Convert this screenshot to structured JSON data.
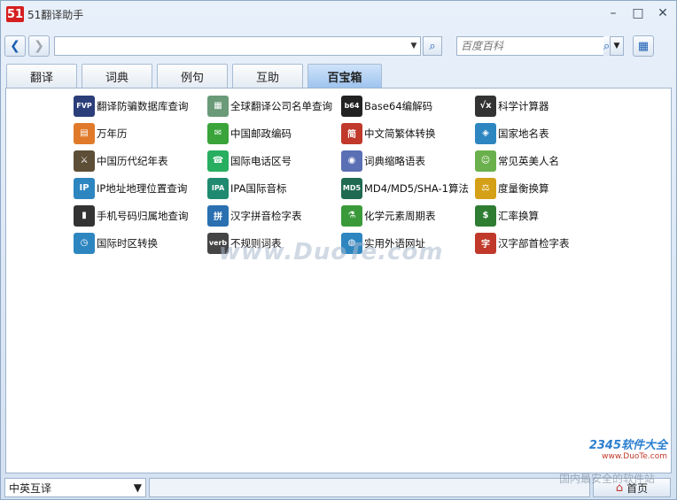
{
  "app": {
    "logo_text": "51",
    "title": "51翻译助手"
  },
  "window_controls": {
    "minimize": "–",
    "maximize": "□",
    "close": "✕"
  },
  "toolbar": {
    "back": "❮",
    "forward": "❯",
    "url_value": "",
    "search_placeholder": "百度百科",
    "dropdown": "▼",
    "search_icon": "⌕",
    "calc_icon": "▦"
  },
  "tabs": [
    {
      "label": "翻译",
      "active": false
    },
    {
      "label": "词典",
      "active": false
    },
    {
      "label": "例句",
      "active": false
    },
    {
      "label": "互助",
      "active": false
    },
    {
      "label": "百宝箱",
      "active": true
    }
  ],
  "tools": [
    {
      "label": "翻译防骗数据库查询",
      "icon": "FVP",
      "color": "#2b3e7a",
      "icon_name": "fraud-database-icon"
    },
    {
      "label": "全球翻译公司名单查询",
      "icon": "▦",
      "color": "#6a9a78",
      "icon_name": "company-list-icon"
    },
    {
      "label": "Base64编解码",
      "icon": "b64",
      "color": "#222222",
      "icon_name": "base64-icon"
    },
    {
      "label": "科学计算器",
      "icon": "√x",
      "color": "#333333",
      "icon_name": "calculator-icon"
    },
    {
      "label": "万年历",
      "icon": "▤",
      "color": "#e07a2a",
      "icon_name": "calendar-icon"
    },
    {
      "label": "中国邮政编码",
      "icon": "✉",
      "color": "#3aa33a",
      "icon_name": "postcode-icon"
    },
    {
      "label": "中文简繁体转换",
      "icon": "简",
      "color": "#c0392b",
      "icon_name": "chinese-convert-icon"
    },
    {
      "label": "国家地名表",
      "icon": "◈",
      "color": "#2e86c1",
      "icon_name": "country-names-icon"
    },
    {
      "label": "中国历代纪年表",
      "icon": "⚔",
      "color": "#5d4e37",
      "icon_name": "chronology-icon"
    },
    {
      "label": "国际电话区号",
      "icon": "☎",
      "color": "#27ae60",
      "icon_name": "phone-code-icon"
    },
    {
      "label": "词典缩略语表",
      "icon": "◉",
      "color": "#5b6fb5",
      "icon_name": "abbreviation-icon"
    },
    {
      "label": "常见英美人名",
      "icon": "☺",
      "color": "#6ab04c",
      "icon_name": "english-names-icon"
    },
    {
      "label": "IP地址地理位置查询",
      "icon": "IP",
      "color": "#2e86c1",
      "icon_name": "ip-lookup-icon"
    },
    {
      "label": "IPA国际音标",
      "icon": "IPA",
      "color": "#1f8a70",
      "icon_name": "ipa-icon"
    },
    {
      "label": "MD4/MD5/SHA-1算法",
      "icon": "MD5",
      "color": "#1f6a50",
      "icon_name": "hash-icon"
    },
    {
      "label": "度量衡换算",
      "icon": "⚖",
      "color": "#d4a017",
      "icon_name": "unit-convert-icon"
    },
    {
      "label": "手机号码归属地查询",
      "icon": "▮",
      "color": "#333333",
      "icon_name": "mobile-lookup-icon"
    },
    {
      "label": "汉字拼音检字表",
      "icon": "拼",
      "color": "#2a6fb0",
      "icon_name": "pinyin-icon"
    },
    {
      "label": "化学元素周期表",
      "icon": "⚗",
      "color": "#3a9a3a",
      "icon_name": "periodic-table-icon"
    },
    {
      "label": "汇率换算",
      "icon": "$",
      "color": "#2e7d32",
      "icon_name": "exchange-rate-icon"
    },
    {
      "label": "国际时区转换",
      "icon": "◷",
      "color": "#2e86c1",
      "icon_name": "timezone-icon"
    },
    {
      "label": "不规则词表",
      "icon": "verb",
      "color": "#444444",
      "icon_name": "irregular-verbs-icon"
    },
    {
      "label": "实用外语网址",
      "icon": "◍",
      "color": "#2e86c1",
      "icon_name": "web-links-icon"
    },
    {
      "label": "汉字部首检字表",
      "icon": "字",
      "color": "#c0392b",
      "icon_name": "radical-icon"
    }
  ],
  "watermark": "www.DuoTe.com",
  "brand": {
    "line1": "2345软件大全",
    "line2": "www.DuoTe.com"
  },
  "statusbar": {
    "language": "中英互译",
    "status_text": "",
    "home_label": "首页",
    "watermark": "国内最安全的软件站"
  }
}
